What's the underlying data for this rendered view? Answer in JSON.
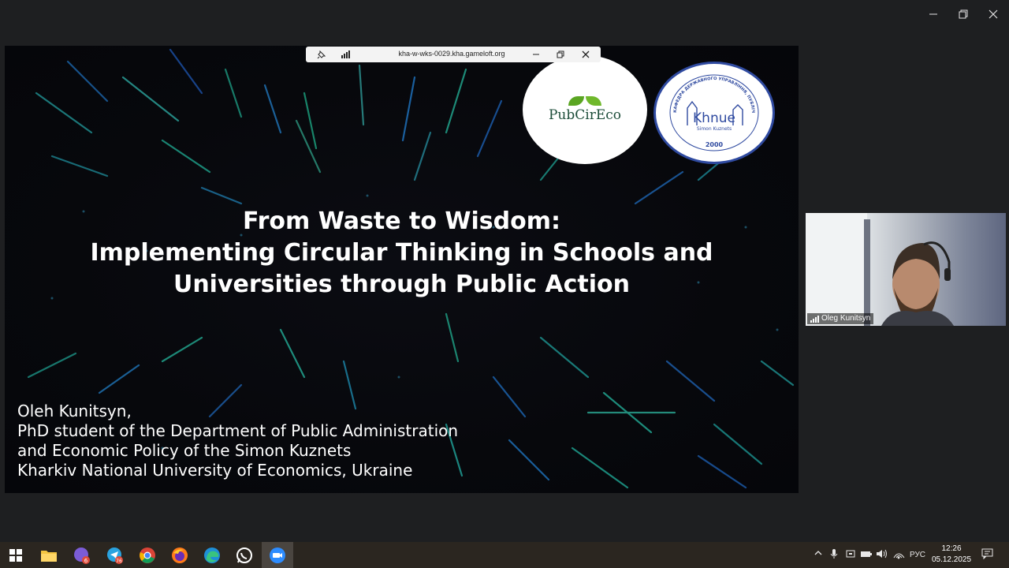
{
  "window": {
    "controls": [
      "minimize-icon",
      "maximize-icon",
      "close-icon"
    ]
  },
  "share_toolbar": {
    "url": "kha-w-wks-0029.kha.gameloft.org",
    "icons": [
      "pin-icon",
      "signal-icon",
      "minimize-icon",
      "restore-icon",
      "close-icon"
    ]
  },
  "slide": {
    "title_lines": [
      "From Waste to Wisdom:",
      "Implementing Circular Thinking in Schools and",
      "Universities through Public Action"
    ],
    "author_lines": [
      "Oleh Kunitsyn,",
      "PhD student of the Department of Public Administration",
      "and Economic Policy of the Simon Kuznets",
      "Kharkiv National University of Economics, Ukraine"
    ],
    "logo_pubcireco": "PubCirEco",
    "logo_knu": {
      "ring_text": "КАФЕДРА ДЕРЖАВНОГО УПРАВЛІННЯ, ПУБЛІЧНОГО АДМІНІСТРУВАННЯ ТА ЕКОНОМІЧНОЇ ПОЛІТИКИ",
      "name": "Khnue",
      "subtitle": "Simon Kuznets",
      "year": "2000"
    }
  },
  "video_tile": {
    "participant_name": "Oleg Kunitsyn"
  },
  "taskbar": {
    "apps": [
      {
        "name": "file-explorer-icon",
        "badge": ""
      },
      {
        "name": "viber-icon",
        "badge": "6"
      },
      {
        "name": "telegram-icon",
        "badge": "76"
      },
      {
        "name": "chrome-icon",
        "badge": ""
      },
      {
        "name": "firefox-icon",
        "badge": ""
      },
      {
        "name": "edge-icon",
        "badge": ""
      },
      {
        "name": "whatsapp-icon",
        "badge": ""
      },
      {
        "name": "zoom-icon",
        "badge": ""
      }
    ],
    "language": "РУС",
    "time": "12:26",
    "date": "05.12.2025"
  },
  "colors": {
    "accent": "#2f4aa0",
    "leaf": "#6fb82b",
    "taskbar": "#2b2620",
    "zoom": "#2d8cff"
  }
}
